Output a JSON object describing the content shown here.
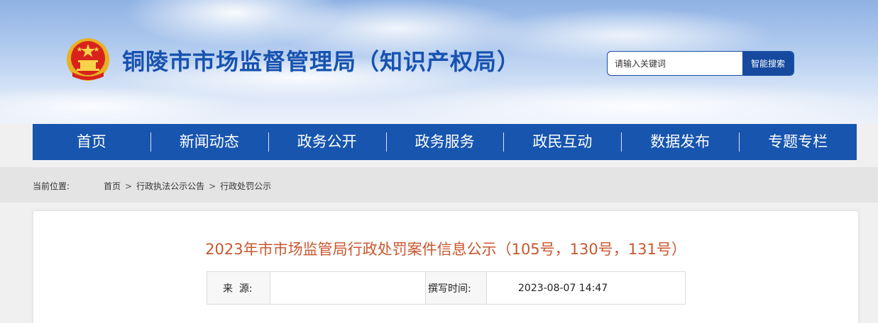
{
  "header": {
    "site_title": "铜陵市市场监督管理局（知识产权局）",
    "search": {
      "placeholder": "请输入关键词",
      "button_label": "智能搜索"
    },
    "emblem_icon": "national-emblem-icon"
  },
  "nav": {
    "items": [
      {
        "label": "首页"
      },
      {
        "label": "新闻动态"
      },
      {
        "label": "政务公开"
      },
      {
        "label": "政务服务"
      },
      {
        "label": "政民互动"
      },
      {
        "label": "数据发布"
      },
      {
        "label": "专题专栏"
      }
    ]
  },
  "breadcrumb": {
    "label": "当前位置:",
    "items": [
      {
        "label": "首页"
      },
      {
        "label": "行政执法公示公告"
      },
      {
        "label": "行政处罚公示"
      }
    ],
    "separator": ">"
  },
  "article": {
    "title": "2023年市市场监管局行政处罚案件信息公示（105号，130号，131号）",
    "source_label": "来  源:",
    "source_value": "",
    "time_label": "撰写时间:",
    "time_value": "2023-08-07 14:47"
  },
  "colors": {
    "brand_blue": "#1755ae",
    "title_blue": "#1752b0",
    "article_title": "#c8572e"
  }
}
